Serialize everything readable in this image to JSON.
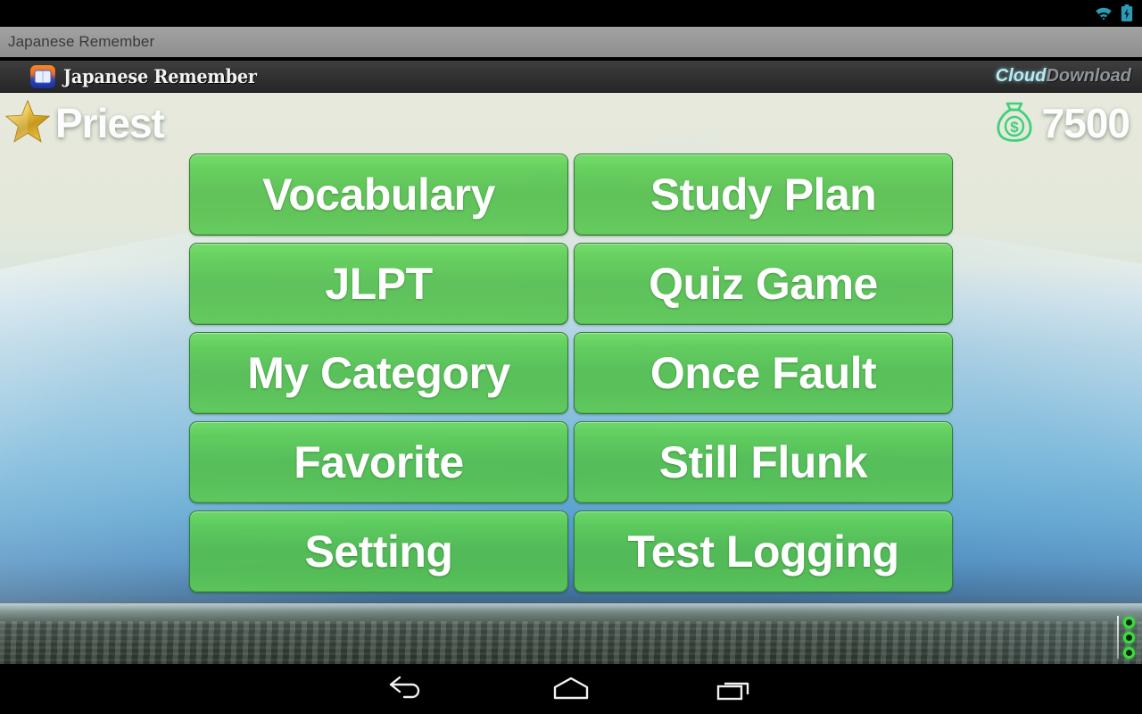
{
  "status_bar": {
    "icons": [
      {
        "name": "wifi-icon",
        "color": "#2d9bb5"
      },
      {
        "name": "battery-charging-icon",
        "color": "#2d9bb5"
      }
    ]
  },
  "app_strip": {
    "label": "Japanese Remember"
  },
  "title_bar": {
    "app_icon": "app-logo-icon",
    "title": "Japanese Remember",
    "brand_primary": "Cloud",
    "brand_secondary": "Download"
  },
  "hud": {
    "rank_icon": "gold-star-icon",
    "rank_label": "Priest",
    "money_icon": "money-bag-icon",
    "money_amount": "7500"
  },
  "menu": {
    "buttons": [
      {
        "label": "Vocabulary",
        "name": "menu-button-vocabulary"
      },
      {
        "label": "Study Plan",
        "name": "menu-button-study-plan"
      },
      {
        "label": "JLPT",
        "name": "menu-button-jlpt"
      },
      {
        "label": "Quiz Game",
        "name": "menu-button-quiz-game"
      },
      {
        "label": "My Category",
        "name": "menu-button-my-category"
      },
      {
        "label": "Once Fault",
        "name": "menu-button-once-fault"
      },
      {
        "label": "Favorite",
        "name": "menu-button-favorite"
      },
      {
        "label": "Still Flunk",
        "name": "menu-button-still-flunk"
      },
      {
        "label": "Setting",
        "name": "menu-button-setting"
      },
      {
        "label": "Test Logging",
        "name": "menu-button-test-logging"
      }
    ]
  },
  "scroll_indicator": {
    "dot_count": 3,
    "dot_color": "#3ddc3d"
  },
  "nav_bar": {
    "buttons": [
      {
        "name": "nav-back-button"
      },
      {
        "name": "nav-home-button"
      },
      {
        "name": "nav-recents-button"
      }
    ]
  },
  "colors": {
    "button_green_top": "#6cdb60",
    "button_green_bottom": "#5cca54",
    "accent_teal": "#2d9bb5",
    "strip_gray": "#979797"
  }
}
